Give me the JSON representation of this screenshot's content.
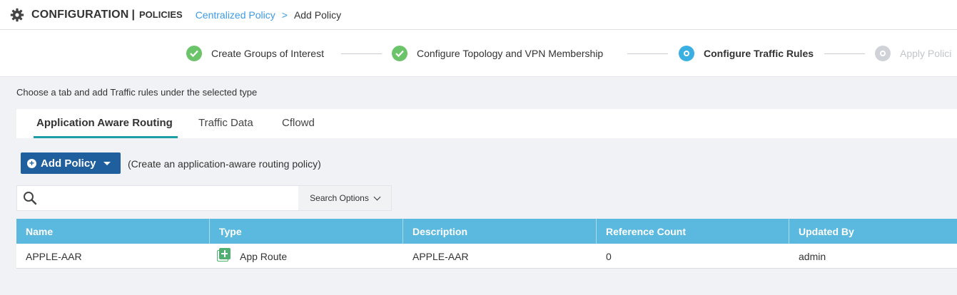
{
  "header": {
    "title": "CONFIGURATION",
    "separator": "|",
    "subtitle": "POLICIES",
    "breadcrumb_link": "Centralized Policy",
    "breadcrumb_arrow": ">",
    "breadcrumb_current": "Add Policy",
    "icon": "gear-icon"
  },
  "steps": [
    {
      "label": "Create Groups of Interest",
      "state": "done"
    },
    {
      "label": "Configure Topology and VPN Membership",
      "state": "done"
    },
    {
      "label": "Configure Traffic Rules",
      "state": "active"
    },
    {
      "label": "Apply Polici",
      "state": "todo"
    }
  ],
  "instruction": "Choose a tab and add Traffic rules under the selected type",
  "tabs": [
    {
      "label": "Application Aware Routing",
      "active": true
    },
    {
      "label": "Traffic Data",
      "active": false
    },
    {
      "label": "Cflowd",
      "active": false
    }
  ],
  "add_policy": {
    "label": "Add Policy",
    "hint": "(Create an application-aware routing policy)"
  },
  "search": {
    "placeholder": "",
    "value": "",
    "options_label": "Search Options"
  },
  "table": {
    "columns": [
      "Name",
      "Type",
      "Description",
      "Reference Count",
      "Updated By"
    ],
    "rows": [
      {
        "name": "APPLE-AAR",
        "type": "App Route",
        "description": "APPLE-AAR",
        "reference_count": "0",
        "updated_by": "admin"
      }
    ]
  },
  "colors": {
    "accent": "#1f5f9e",
    "link": "#3c9be8",
    "table_header": "#5bb9e0",
    "step_done": "#6cc46a",
    "step_active": "#3ab0e2",
    "tab_underline": "#1c9ea6"
  }
}
